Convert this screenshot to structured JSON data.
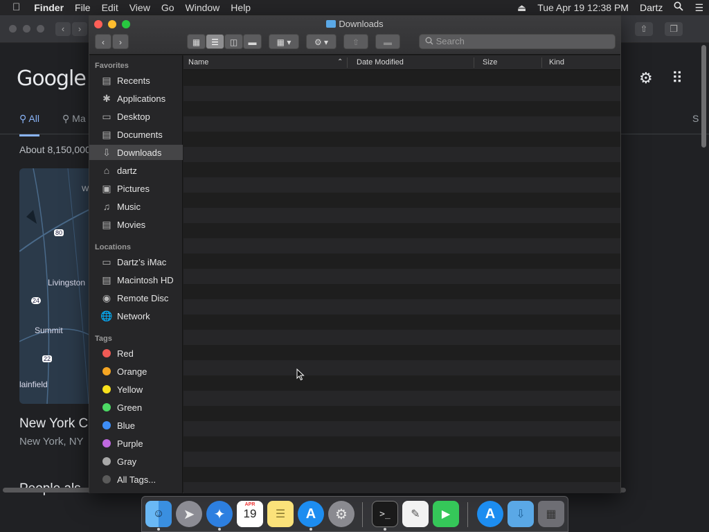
{
  "menubar": {
    "apple": "",
    "finder": "Finder",
    "file": "File",
    "edit": "Edit",
    "view": "View",
    "go": "Go",
    "window": "Window",
    "help": "Help",
    "datetime": "Tue Apr 19  12:38 PM",
    "user": "Dartz"
  },
  "browser": {
    "logo": "Google",
    "tab_all": "All",
    "tab_maps": "Ma",
    "tab_right": "S",
    "result_count": "About 8,150,000",
    "map_labels": {
      "w": "W",
      "i80": "80",
      "livingston": "Livingston",
      "r24": "24",
      "summit": "Summit",
      "r22": "22",
      "plainfield": "lainfield"
    },
    "place_title": "New York C",
    "place_sub": "New York, NY",
    "people_also": "People als"
  },
  "finder": {
    "title": "Downloads",
    "search_placeholder": "Search",
    "sidebar": {
      "favorites_header": "Favorites",
      "favorites": [
        {
          "label": "Recents",
          "icon": "recents-icon"
        },
        {
          "label": "Applications",
          "icon": "applications-icon"
        },
        {
          "label": "Desktop",
          "icon": "desktop-icon"
        },
        {
          "label": "Documents",
          "icon": "documents-icon"
        },
        {
          "label": "Downloads",
          "icon": "downloads-icon"
        },
        {
          "label": "dartz",
          "icon": "home-icon"
        },
        {
          "label": "Pictures",
          "icon": "pictures-icon"
        },
        {
          "label": "Music",
          "icon": "music-icon"
        },
        {
          "label": "Movies",
          "icon": "movies-icon"
        }
      ],
      "locations_header": "Locations",
      "locations": [
        {
          "label": "Dartz’s iMac",
          "icon": "imac-icon"
        },
        {
          "label": "Macintosh HD",
          "icon": "disk-icon"
        },
        {
          "label": "Remote Disc",
          "icon": "remote-disc-icon"
        },
        {
          "label": "Network",
          "icon": "network-icon"
        }
      ],
      "tags_header": "Tags",
      "tags": [
        {
          "label": "Red",
          "color": "#f05a55"
        },
        {
          "label": "Orange",
          "color": "#f5a623"
        },
        {
          "label": "Yellow",
          "color": "#f8e11c"
        },
        {
          "label": "Green",
          "color": "#4cd964"
        },
        {
          "label": "Blue",
          "color": "#3e8ef7"
        },
        {
          "label": "Purple",
          "color": "#c069e0"
        },
        {
          "label": "Gray",
          "color": "#a8a8a8"
        },
        {
          "label": "All Tags...",
          "color": "#5a5a5a"
        }
      ]
    },
    "columns": {
      "name": "Name",
      "date": "Date Modified",
      "size": "Size",
      "kind": "Kind"
    }
  },
  "dock": {
    "calendar_month": "APR",
    "calendar_day": "19"
  }
}
